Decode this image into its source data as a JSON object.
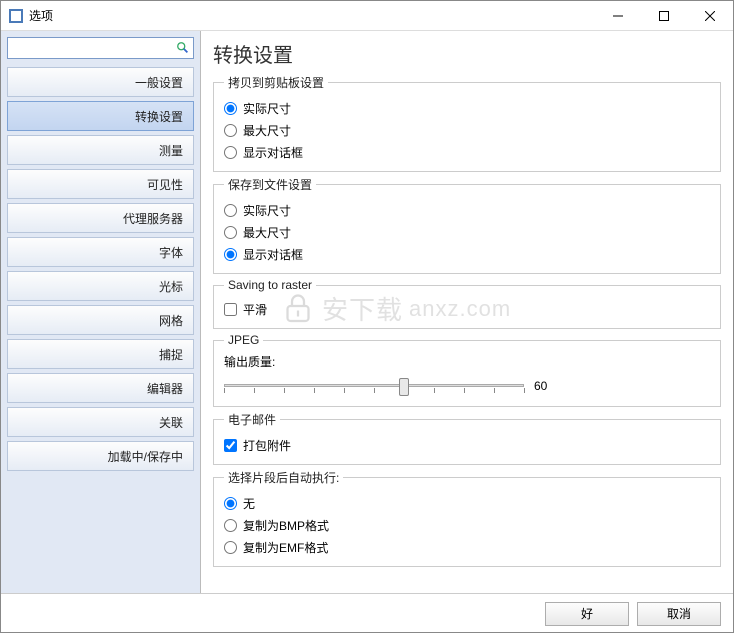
{
  "window": {
    "title": "选项"
  },
  "sidebar": {
    "search_placeholder": "",
    "items": [
      {
        "label": "一般设置"
      },
      {
        "label": "转换设置"
      },
      {
        "label": "测量"
      },
      {
        "label": "可见性"
      },
      {
        "label": "代理服务器"
      },
      {
        "label": "字体"
      },
      {
        "label": "光标"
      },
      {
        "label": "网格"
      },
      {
        "label": "捕捉"
      },
      {
        "label": "编辑器"
      },
      {
        "label": "关联"
      },
      {
        "label": "加载中/保存中"
      }
    ],
    "selected_index": 1
  },
  "page": {
    "title": "转换设置"
  },
  "clipboard": {
    "legend": "拷贝到剪贴板设置",
    "opt_actual": "实际尺寸",
    "opt_max": "最大尺寸",
    "opt_dialog": "显示对话框",
    "selected": "actual"
  },
  "savefile": {
    "legend": "保存到文件设置",
    "opt_actual": "实际尺寸",
    "opt_max": "最大尺寸",
    "opt_dialog": "显示对话框",
    "selected": "dialog"
  },
  "raster": {
    "legend": "Saving to raster",
    "smooth_label": "平滑",
    "smooth_checked": false
  },
  "jpeg": {
    "legend": "JPEG",
    "quality_label": "输出质量:",
    "quality_value": "60",
    "quality_pct": 60
  },
  "email": {
    "legend": "电子邮件",
    "pack_label": "打包附件",
    "pack_checked": true
  },
  "autorun": {
    "legend": "选择片段后自动执行:",
    "opt_none": "无",
    "opt_bmp": "复制为BMP格式",
    "opt_emf": "复制为EMF格式",
    "selected": "none"
  },
  "footer": {
    "ok": "好",
    "cancel": "取消"
  },
  "watermark": {
    "cn": "安下载",
    "en": "anxz.com"
  }
}
